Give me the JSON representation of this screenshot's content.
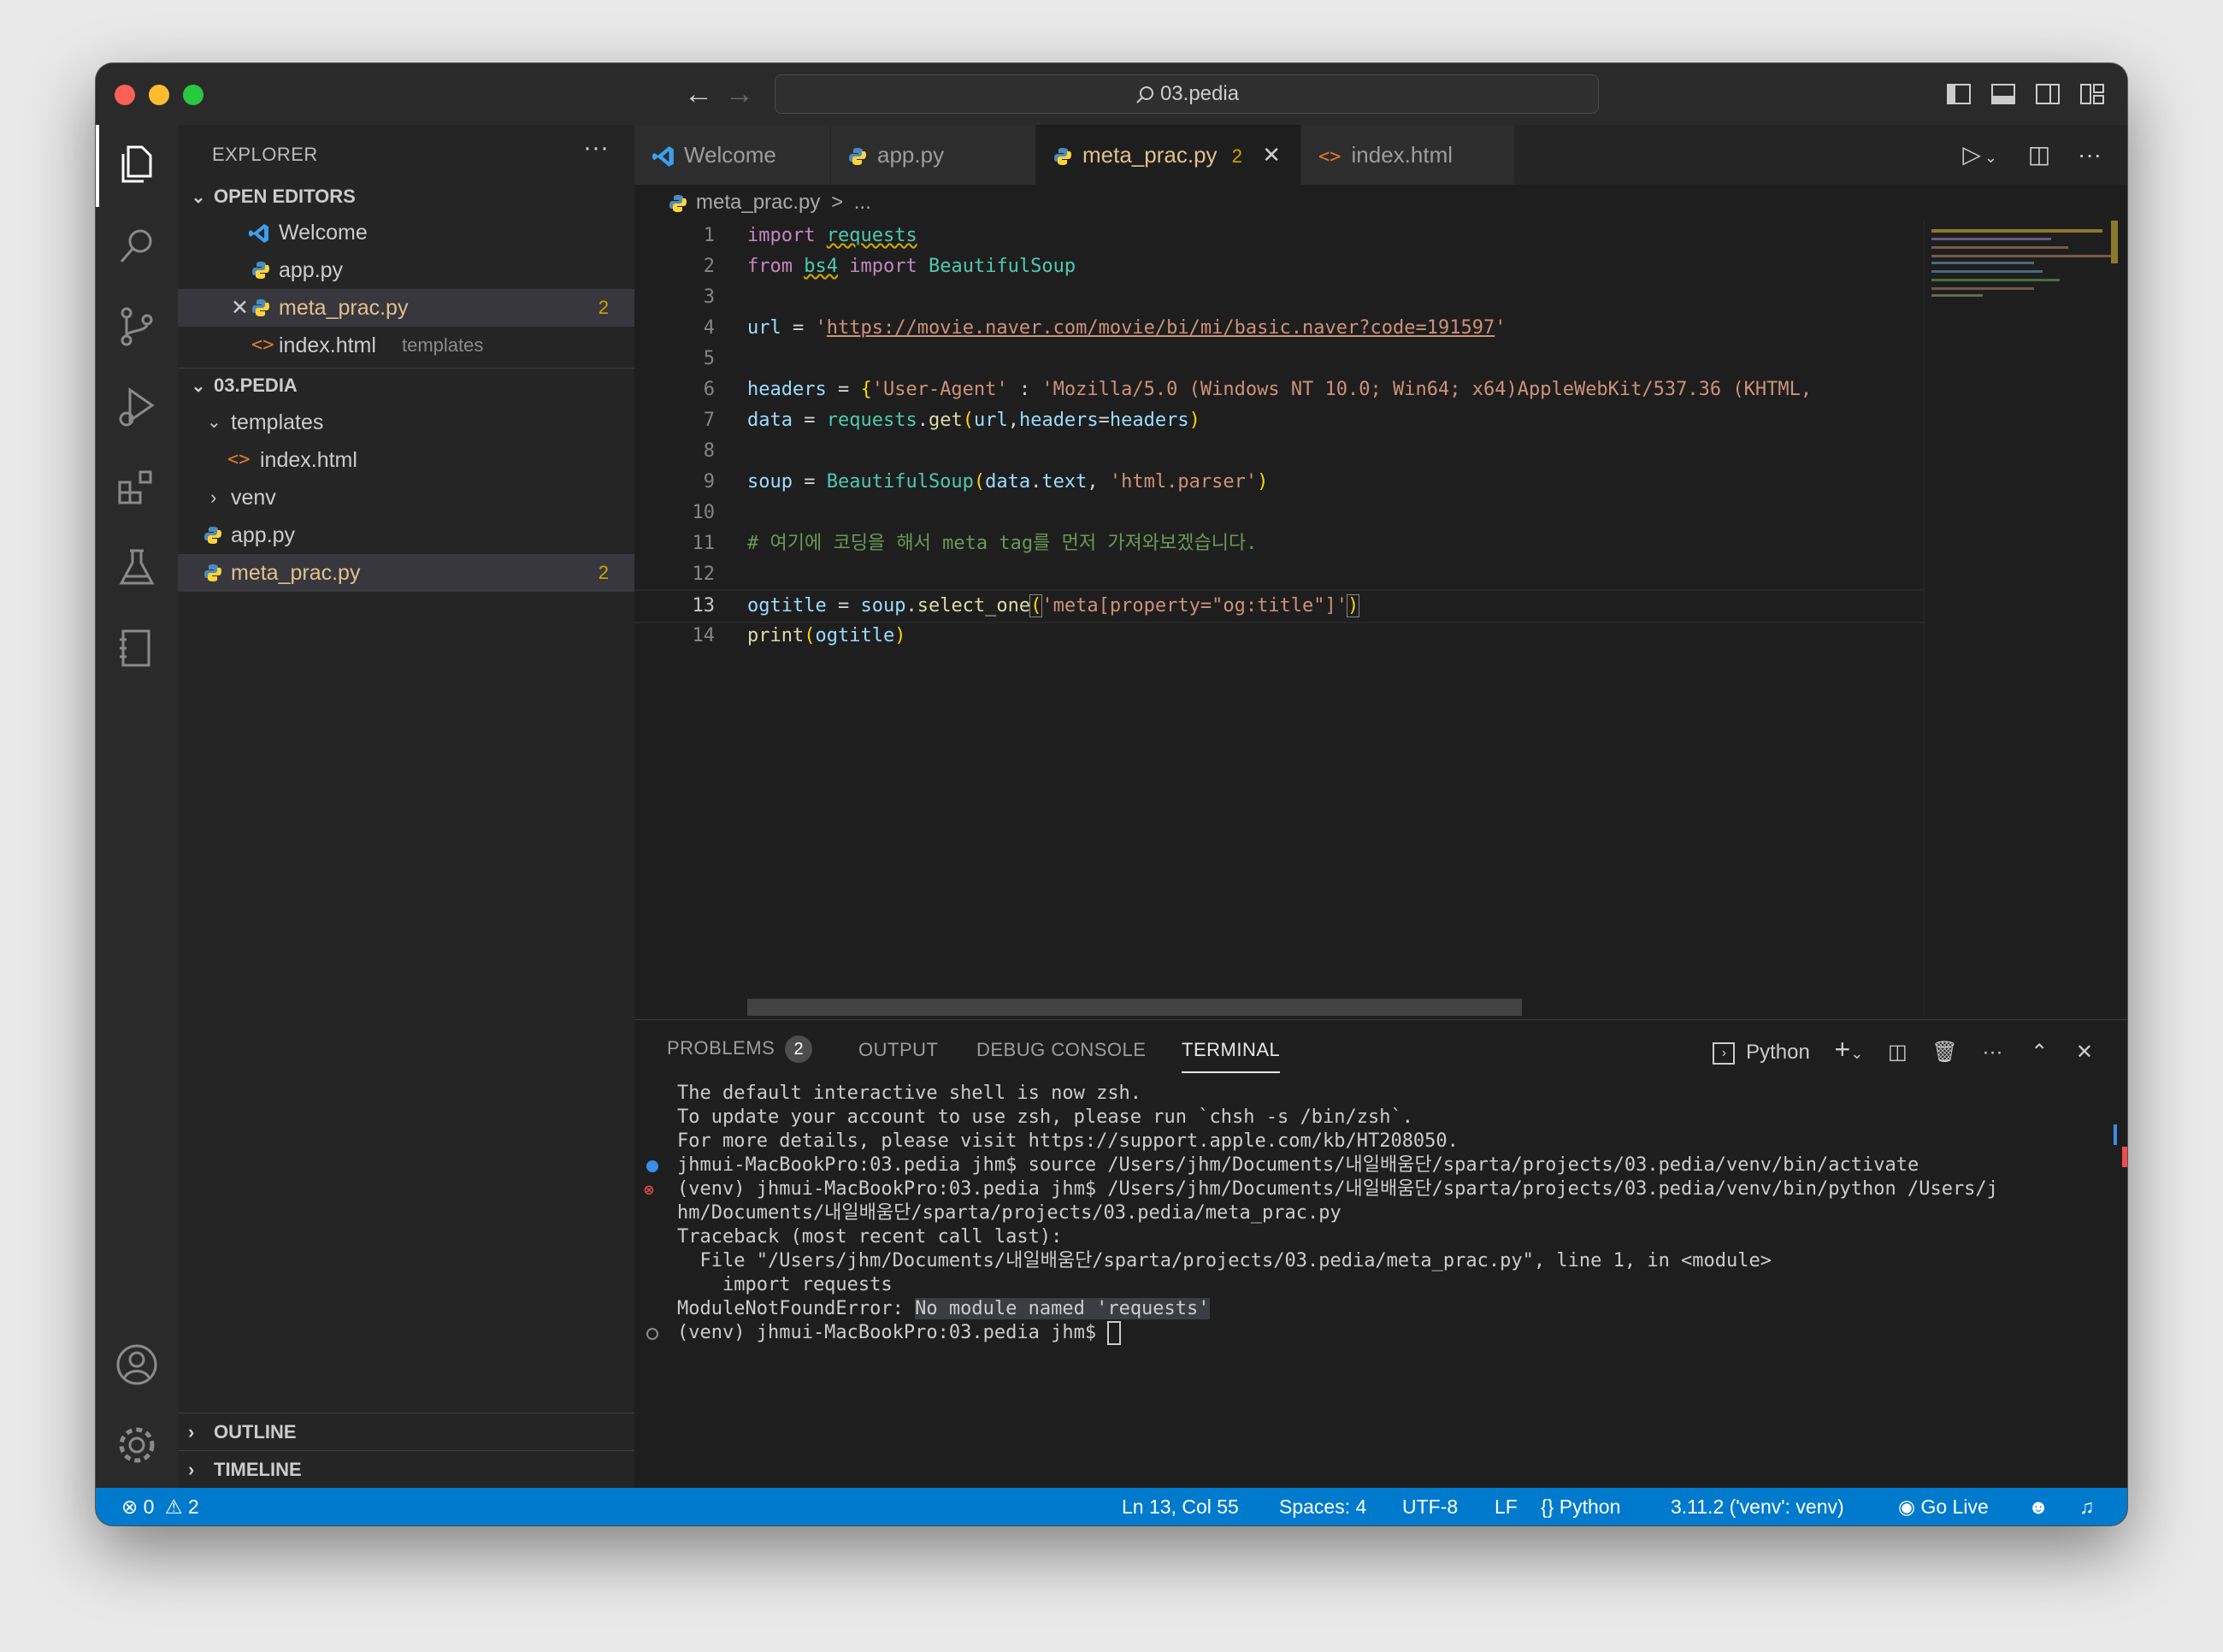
{
  "window": {
    "search_title": "03.pedia"
  },
  "sidebar": {
    "title": "EXPLORER",
    "more": "···",
    "open_editors": {
      "header": "OPEN EDITORS",
      "items": [
        {
          "label": "Welcome",
          "extra": "",
          "badge": ""
        },
        {
          "label": "app.py",
          "extra": "",
          "badge": ""
        },
        {
          "label": "meta_prac.py",
          "extra": "",
          "badge": "2"
        },
        {
          "label": "index.html",
          "extra": "templates",
          "badge": ""
        }
      ]
    },
    "project": {
      "header": "03.PEDIA",
      "items": [
        {
          "label": "templates"
        },
        {
          "label": "index.html"
        },
        {
          "label": "venv"
        },
        {
          "label": "app.py"
        },
        {
          "label": "meta_prac.py",
          "badge": "2"
        }
      ]
    },
    "outline": "OUTLINE",
    "timeline": "TIMELINE"
  },
  "tabs": [
    {
      "label": "Welcome"
    },
    {
      "label": "app.py"
    },
    {
      "label": "meta_prac.py",
      "badge": "2"
    },
    {
      "label": "index.html"
    }
  ],
  "breadcrumb": {
    "file": "meta_prac.py",
    "sep": ">",
    "rest": "..."
  },
  "code": {
    "line_numbers": [
      "1",
      "2",
      "3",
      "4",
      "5",
      "6",
      "7",
      "8",
      "9",
      "10",
      "11",
      "12",
      "13",
      "14"
    ],
    "l1": {
      "kw": "import",
      "mod": "requests"
    },
    "l2": {
      "kw1": "from",
      "mod": "bs4",
      "kw2": "import",
      "cls": "BeautifulSoup"
    },
    "l4": {
      "var": "url",
      "eq": " = ",
      "q1": "'",
      "url": "https://movie.naver.com/movie/bi/mi/basic.naver?code=191597",
      "q2": "'"
    },
    "l6": {
      "var": "headers",
      "eq": " = ",
      "open": "{",
      "key": "'User-Agent'",
      "colon": " : ",
      "val": "'Mozilla/5.0 (Windows NT 10.0; Win64; x64)AppleWebKit/537.36 (KHTML, "
    },
    "l7": {
      "var": "data",
      "eq": " = ",
      "obj": "requests",
      "dot": ".",
      "fn": "get",
      "open": "(",
      "a1": "url",
      "comma": ",",
      "a2": "headers",
      "eq2": "=",
      "a3": "headers",
      "close": ")"
    },
    "l9": {
      "var": "soup",
      "eq": " = ",
      "cls": "BeautifulSoup",
      "open": "(",
      "a1": "data",
      "dot": ".",
      "a2": "text",
      "comma": ", ",
      "str": "'html.parser'",
      "close": ")"
    },
    "l11": {
      "comment": "# 여기에 코딩을 해서 meta tag를 먼저 가져와보겠습니다."
    },
    "l13": {
      "var": "ogtitle",
      "eq": " = ",
      "obj": "soup",
      "dot": ".",
      "fn": "select_one",
      "open": "(",
      "str": "'meta[property=\"og:title\"]'",
      "close": ")"
    },
    "l14": {
      "fn": "print",
      "open": "(",
      "arg": "ogtitle",
      "close": ")"
    }
  },
  "panel": {
    "tabs": {
      "problems": "PROBLEMS",
      "problems_count": "2",
      "output": "OUTPUT",
      "debug": "DEBUG CONSOLE",
      "terminal": "TERMINAL"
    },
    "shell_label": "Python",
    "terminal_lines": [
      "The default interactive shell is now zsh.",
      "To update your account to use zsh, please run `chsh -s /bin/zsh`.",
      "For more details, please visit https://support.apple.com/kb/HT208050.",
      "jhmui-MacBookPro:03.pedia jhm$ source /Users/jhm/Documents/내일배움단/sparta/projects/03.pedia/venv/bin/activate",
      "(venv) jhmui-MacBookPro:03.pedia jhm$ /Users/jhm/Documents/내일배움단/sparta/projects/03.pedia/venv/bin/python /Users/j",
      "hm/Documents/내일배움단/sparta/projects/03.pedia/meta_prac.py",
      "Traceback (most recent call last):",
      "  File \"/Users/jhm/Documents/내일배움단/sparta/projects/03.pedia/meta_prac.py\", line 1, in <module>",
      "    import requests",
      "ModuleNotFoundError: ",
      "No module named 'requests'",
      "(venv) jhmui-MacBookPro:03.pedia jhm$ "
    ]
  },
  "statusbar": {
    "errors": "0",
    "warnings": "2",
    "position": "Ln 13, Col 55",
    "spaces": "Spaces: 4",
    "encoding": "UTF-8",
    "eol": "LF",
    "language": "Python",
    "interpreter": "3.11.2 ('venv': venv)",
    "golive": "Go Live"
  },
  "colors": {
    "accent": "#007acc",
    "modified": "#e2c08d",
    "warning": "#cca700",
    "error": "#f14c4c"
  }
}
